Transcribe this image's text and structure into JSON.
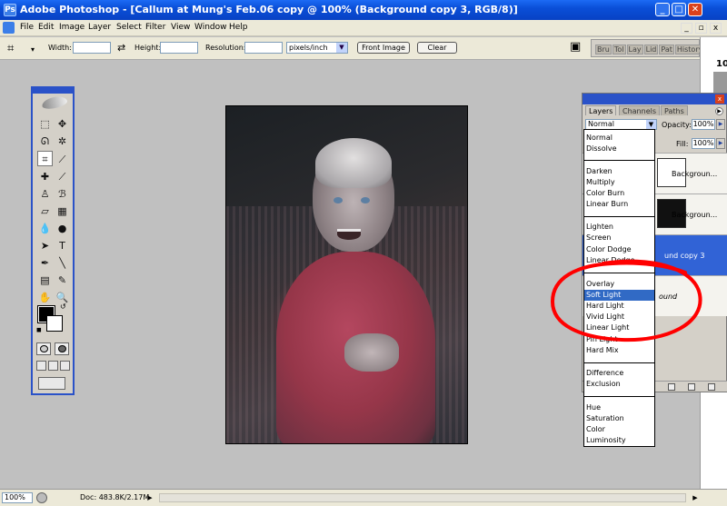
{
  "window": {
    "app_name": "Adobe Photoshop",
    "title": "Adobe Photoshop - [Callum at Mung's Feb.06 copy @ 100% (Background copy 3, RGB/8)]",
    "minimize": "_",
    "maximize": "□",
    "close": "✕"
  },
  "menu": {
    "items": [
      "File",
      "Edit",
      "Image",
      "Layer",
      "Select",
      "Filter",
      "View",
      "Window",
      "Help"
    ],
    "doc_buttons": [
      "_",
      "▫",
      "x"
    ]
  },
  "options": {
    "width_label": "Width:",
    "height_label": "Height:",
    "resolution_label": "Resolution:",
    "units": "pixels/inch",
    "front_image": "Front Image",
    "clear": "Clear"
  },
  "palette_well": {
    "tabs": [
      "Bru",
      "Tol",
      "Lay",
      "Lid",
      "Pat",
      "History"
    ]
  },
  "right_strip": {
    "number": "10"
  },
  "layers_panel": {
    "tabs": [
      "Layers",
      "Channels",
      "Paths"
    ],
    "blend_mode": "Normal",
    "opacity_label": "Opacity:",
    "opacity_value": "100%",
    "fill_label": "Fill:",
    "fill_value": "100%",
    "layers": [
      {
        "name": "Backgroun..."
      },
      {
        "name": "Backgroun..."
      },
      {
        "name": "und copy 3"
      },
      {
        "name": "ound"
      }
    ]
  },
  "blend_list": {
    "groups": [
      [
        "Normal",
        "Dissolve"
      ],
      [
        "Darken",
        "Multiply",
        "Color Burn",
        "Linear Burn"
      ],
      [
        "Lighten",
        "Screen",
        "Color Dodge",
        "Linear Dodge"
      ],
      [
        "Overlay",
        "Soft Light",
        "Hard Light",
        "Vivid Light",
        "Linear Light",
        "Pin Light",
        "Hard Mix"
      ],
      [
        "Difference",
        "Exclusion"
      ],
      [
        "Hue",
        "Saturation",
        "Color",
        "Luminosity"
      ]
    ],
    "highlighted": "Soft Light"
  },
  "status": {
    "zoom": "100%",
    "doc": "Doc: 483.8K/2.17M"
  },
  "colors": {
    "title_blue": "#0a4fd8",
    "highlight": "#316ac5",
    "annotation_red": "#ff0000"
  }
}
